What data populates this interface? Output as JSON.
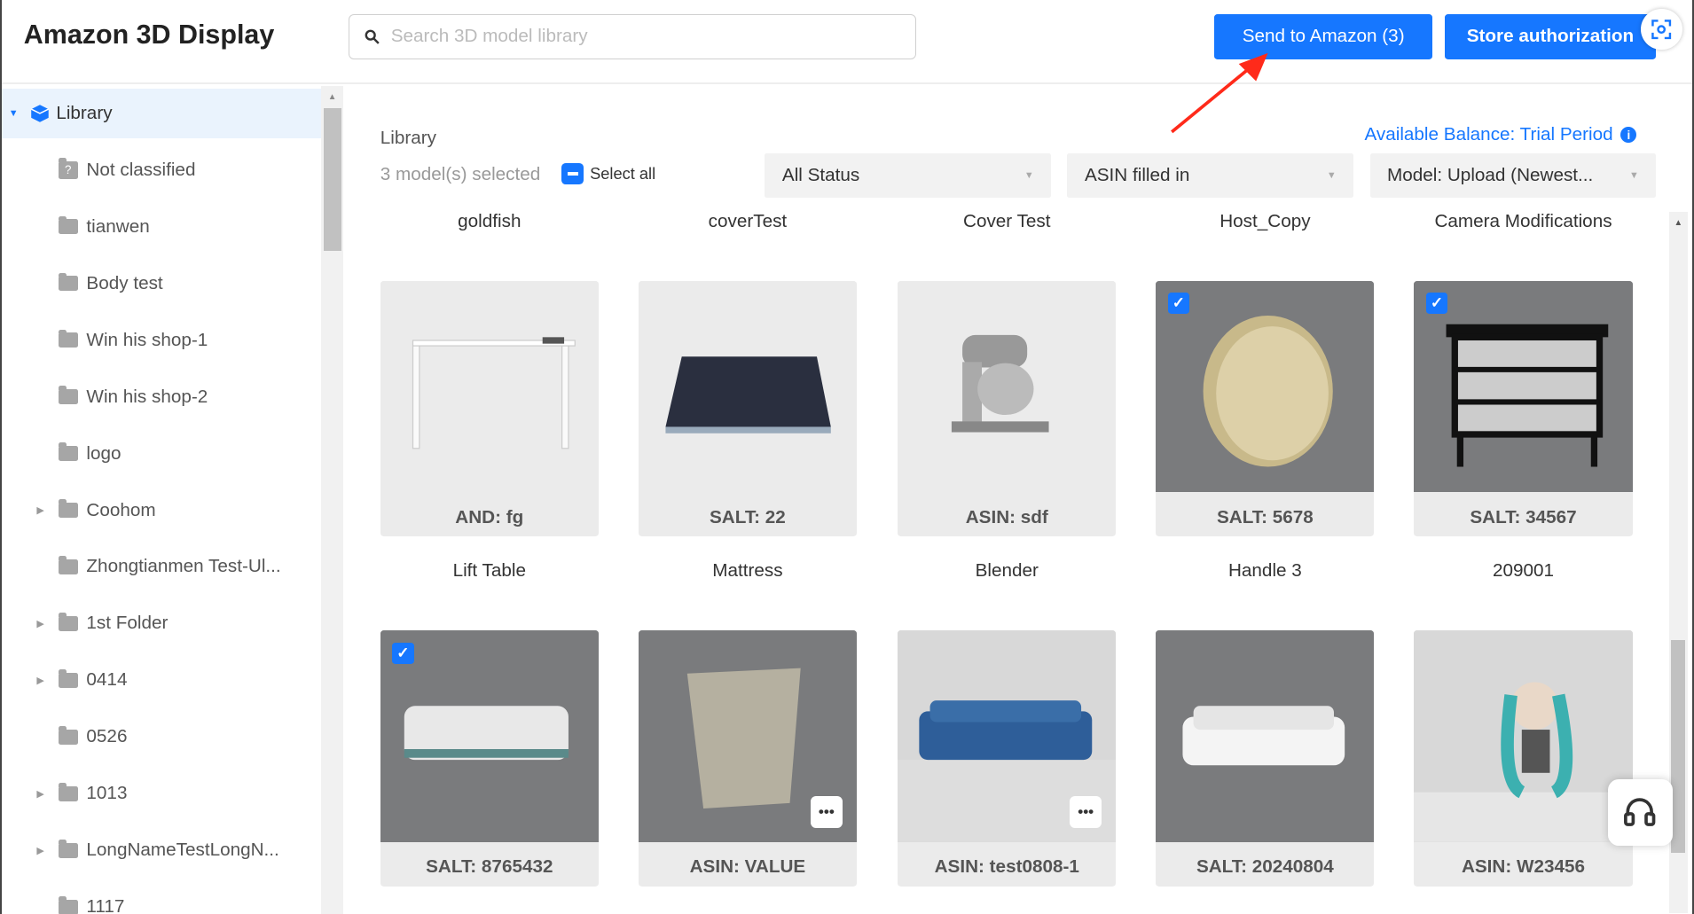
{
  "header": {
    "title": "Amazon 3D Display",
    "search_placeholder": "Search 3D model library",
    "send_button": "Send to Amazon (3)",
    "store_button": "Store authorization"
  },
  "sidebar": {
    "items": [
      {
        "label": "Library",
        "active": true,
        "expandable": true,
        "expanded": true
      },
      {
        "label": "Not classified"
      },
      {
        "label": "tianwen"
      },
      {
        "label": "Body test"
      },
      {
        "label": "Win his shop-1"
      },
      {
        "label": "Win his shop-2"
      },
      {
        "label": "logo"
      },
      {
        "label": "Coohom",
        "expandable": true
      },
      {
        "label": "Zhongtianmen Test-Ul..."
      },
      {
        "label": "1st Folder",
        "expandable": true
      },
      {
        "label": "0414",
        "expandable": true
      },
      {
        "label": "0526"
      },
      {
        "label": "1013",
        "expandable": true
      },
      {
        "label": "LongNameTestLongN...",
        "expandable": true
      },
      {
        "label": "1117"
      }
    ]
  },
  "main": {
    "breadcrumb": "Library",
    "selected_count": "3 model(s) selected",
    "select_all": "Select all",
    "filters": {
      "status": "All Status",
      "asin": "ASIN filled in",
      "sort": "Model: Upload (Newest..."
    },
    "balance": "Available Balance: Trial Period",
    "top_names": [
      "goldfish",
      "coverTest",
      "Cover Test",
      "Host_Copy",
      "Camera Modifications"
    ],
    "rows": [
      {
        "cards": [
          {
            "label": "AND: fg",
            "checked": false,
            "theme": "light",
            "name": "Lift Table"
          },
          {
            "label": "SALT: 22",
            "checked": false,
            "theme": "light",
            "name": "Mattress"
          },
          {
            "label": "ASIN: sdf",
            "checked": false,
            "theme": "light",
            "name": "Blender"
          },
          {
            "label": "SALT: 5678",
            "checked": true,
            "theme": "dark",
            "name": "Handle 3"
          },
          {
            "label": "SALT: 34567",
            "checked": true,
            "theme": "dark",
            "name": "209001"
          }
        ]
      },
      {
        "cards": [
          {
            "label": "SALT: 8765432",
            "checked": true,
            "theme": "dark",
            "more": false
          },
          {
            "label": "ASIN: VALUE",
            "checked": false,
            "theme": "dark",
            "more": true
          },
          {
            "label": "ASIN: test0808-1",
            "checked": false,
            "theme": "room",
            "more": true
          },
          {
            "label": "SALT: 20240804",
            "checked": false,
            "theme": "dark",
            "more": false
          },
          {
            "label": "ASIN: W23456",
            "checked": false,
            "theme": "room",
            "more": false
          }
        ]
      }
    ]
  },
  "colors": {
    "accent": "#1677ff",
    "arrow": "#ff2a1a"
  }
}
